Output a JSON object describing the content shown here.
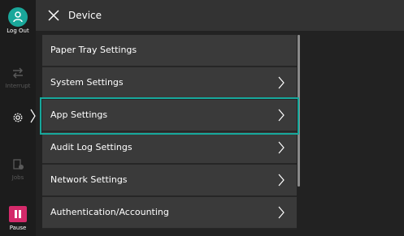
{
  "sidebar": {
    "logout_label": "Log Out",
    "interrupt_label": "Interrupt",
    "jobs_label": "Jobs",
    "pause_label": "Pause"
  },
  "header": {
    "title": "Device"
  },
  "menu": {
    "items": [
      {
        "label": "Paper Tray Settings",
        "has_chevron": false,
        "selected": false
      },
      {
        "label": "System Settings",
        "has_chevron": true,
        "selected": false
      },
      {
        "label": "App Settings",
        "has_chevron": true,
        "selected": true
      },
      {
        "label": "Audit Log Settings",
        "has_chevron": true,
        "selected": false
      },
      {
        "label": "Network Settings",
        "has_chevron": true,
        "selected": false
      },
      {
        "label": "Authentication/Accounting",
        "has_chevron": true,
        "selected": false
      }
    ]
  },
  "colors": {
    "accent": "#17a89c",
    "logout": "#1aa79a",
    "pause": "#d42a6a"
  },
  "icons": [
    "logout-icon",
    "interrupt-icon",
    "gear-icon",
    "jobs-icon",
    "pause-icon",
    "close-icon",
    "chevron-right-icon"
  ]
}
